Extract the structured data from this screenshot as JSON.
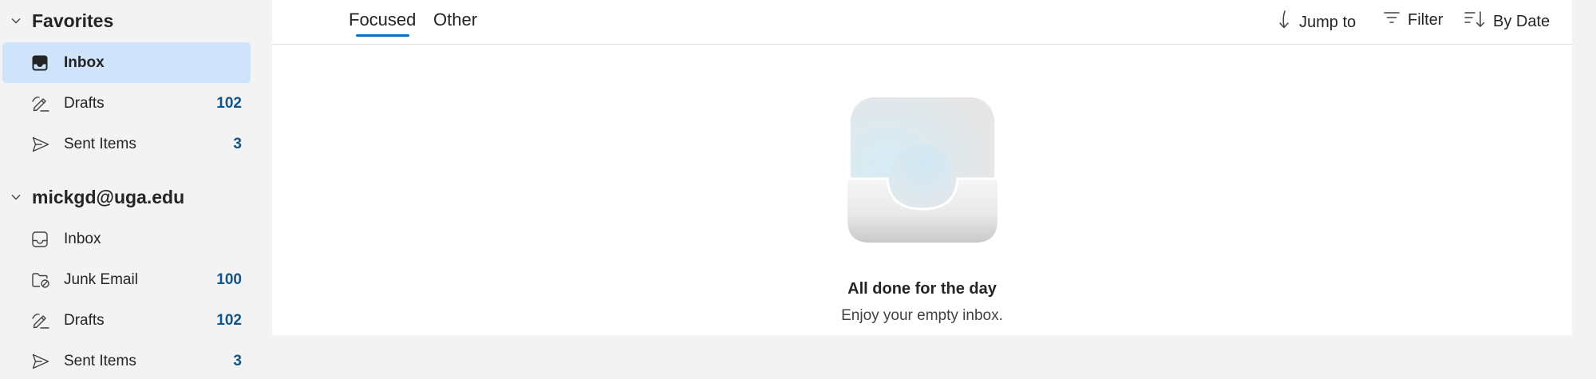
{
  "favorites": {
    "title": "Favorites",
    "items": [
      {
        "label": "Inbox",
        "count": "",
        "icon": "inbox-filled-icon"
      },
      {
        "label": "Drafts",
        "count": "102",
        "icon": "drafts-pen-icon"
      },
      {
        "label": "Sent Items",
        "count": "3",
        "icon": "send-icon"
      }
    ]
  },
  "account": {
    "title": "mickgd@uga.edu",
    "items": [
      {
        "label": "Inbox",
        "count": "",
        "icon": "inbox-icon"
      },
      {
        "label": "Junk Email",
        "count": "100",
        "icon": "junk-folder-icon"
      },
      {
        "label": "Drafts",
        "count": "102",
        "icon": "drafts-pen-icon"
      },
      {
        "label": "Sent Items",
        "count": "3",
        "icon": "send-icon"
      }
    ]
  },
  "toolbar": {
    "tabs": [
      "Focused",
      "Other"
    ],
    "active_tab": "Focused",
    "jump_to": "Jump to",
    "filter": "Filter",
    "sort": "By Date"
  },
  "empty_state": {
    "title": "All done for the day",
    "subtitle": "Enjoy your empty inbox."
  },
  "colors": {
    "accent": "#0f6cbd",
    "selected_bg": "#cfe4fa",
    "count_text": "#0f548c"
  }
}
